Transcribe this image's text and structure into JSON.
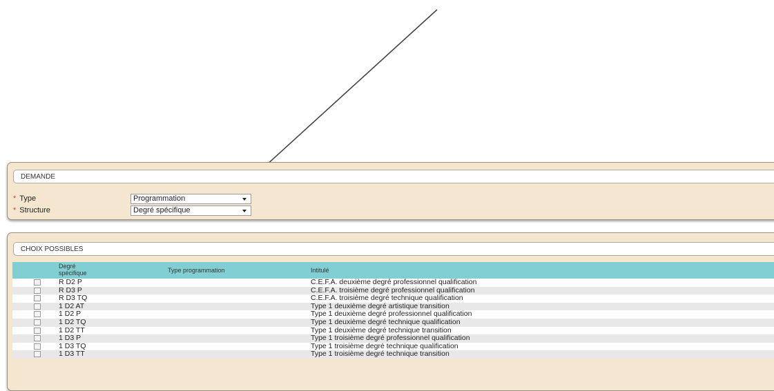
{
  "demande": {
    "title": "DEMANDE",
    "fields": [
      {
        "required": "*",
        "label": "Type",
        "value": "Programmation"
      },
      {
        "required": "*",
        "label": "Structure",
        "value": "Degré spécifique"
      }
    ]
  },
  "choix": {
    "title": "CHOIX POSSIBLES",
    "columns": {
      "degre": "Degré spécifique",
      "type": "Type programmation",
      "intitule": "Intitulé"
    },
    "rows": [
      {
        "degre": "R D2 P",
        "intitule": "C.E.F.A. deuxième degré professionnel qualification"
      },
      {
        "degre": "R D3 P",
        "intitule": "C.E.F.A. troisième degré professionnel qualification"
      },
      {
        "degre": "R D3 TQ",
        "intitule": "C.E.F.A. troisième degré technique qualification"
      },
      {
        "degre": "1 D2 AT",
        "intitule": "Type 1 deuxième degré artistique transition"
      },
      {
        "degre": "1 D2 P",
        "intitule": "Type 1 deuxième degré professionnel qualification"
      },
      {
        "degre": "1 D2 TQ",
        "intitule": "Type 1 deuxième degré technique qualification"
      },
      {
        "degre": "1 D2 TT",
        "intitule": "Type 1 deuxième degré technique transition"
      },
      {
        "degre": "1 D3 P",
        "intitule": "Type 1 troisième degré professionnel qualification"
      },
      {
        "degre": "1 D3 TQ",
        "intitule": "Type 1 troisième degré technique qualification"
      },
      {
        "degre": "1 D3 TT",
        "intitule": "Type 1 troisième degré technique transition"
      }
    ]
  },
  "colors": {
    "panel_bg": "#f4e6cf",
    "table_header": "#82cfd3",
    "row_alt": "#e8e8e8"
  }
}
